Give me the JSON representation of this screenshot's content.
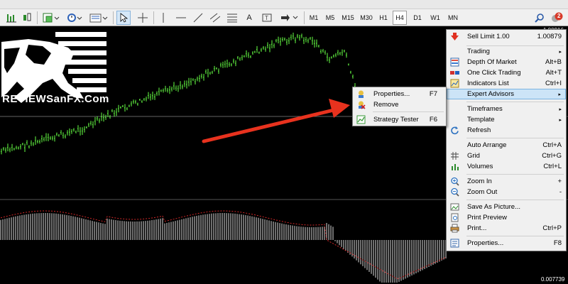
{
  "toolbar": {
    "timeframes": [
      "M1",
      "M5",
      "M15",
      "M30",
      "H1",
      "H4",
      "D1",
      "W1",
      "MN"
    ],
    "active_timeframe": "H4",
    "text_tool": "A",
    "notification_count": "2"
  },
  "chart": {
    "top_price": "1.00916",
    "bottom_price": "0.007739",
    "hline_color": "#c8c8c8",
    "candle_color": "#66ff44",
    "arrow_color": "#e8321e"
  },
  "logo": {
    "text": "REVIEWSanFX.Com"
  },
  "main_menu": {
    "items": [
      {
        "label": "Sell Limit 1.00",
        "shortcut": "1.00879",
        "icon": "sell-limit-icon"
      },
      {
        "label": "Trading",
        "arrow": "▸"
      },
      {
        "label": "Depth Of Market",
        "shortcut": "Alt+B",
        "icon": "depth-of-market-icon"
      },
      {
        "label": "One Click Trading",
        "shortcut": "Alt+T",
        "icon": "one-click-trading-icon"
      },
      {
        "label": "Indicators List",
        "shortcut": "Ctrl+I",
        "icon": "indicators-list-icon"
      },
      {
        "label": "Expert Advisors",
        "arrow": "▸"
      },
      {
        "label": "Timeframes",
        "arrow": "▸"
      },
      {
        "label": "Template",
        "arrow": "▸"
      },
      {
        "label": "Refresh",
        "icon": "refresh-icon"
      },
      {
        "label": "Auto Arrange",
        "shortcut": "Ctrl+A"
      },
      {
        "label": "Grid",
        "shortcut": "Ctrl+G",
        "icon": "grid-icon"
      },
      {
        "label": "Volumes",
        "shortcut": "Ctrl+L",
        "icon": "volumes-icon"
      },
      {
        "label": "Zoom In",
        "shortcut": "+",
        "icon": "zoom-in-icon"
      },
      {
        "label": "Zoom Out",
        "shortcut": "-",
        "icon": "zoom-out-icon"
      },
      {
        "label": "Save As Picture...",
        "icon": "save-picture-icon"
      },
      {
        "label": "Print Preview",
        "icon": "print-preview-icon"
      },
      {
        "label": "Print...",
        "shortcut": "Ctrl+P",
        "icon": "print-icon"
      },
      {
        "label": "Properties...",
        "shortcut": "F8",
        "icon": "properties-icon"
      }
    ]
  },
  "sub_menu": {
    "items": [
      {
        "label": "Properties...",
        "shortcut": "F7",
        "icon": "ea-properties-icon"
      },
      {
        "label": "Remove",
        "icon": "ea-remove-icon"
      },
      {
        "label": "Strategy Tester",
        "shortcut": "F6",
        "icon": "strategy-tester-icon"
      }
    ]
  }
}
